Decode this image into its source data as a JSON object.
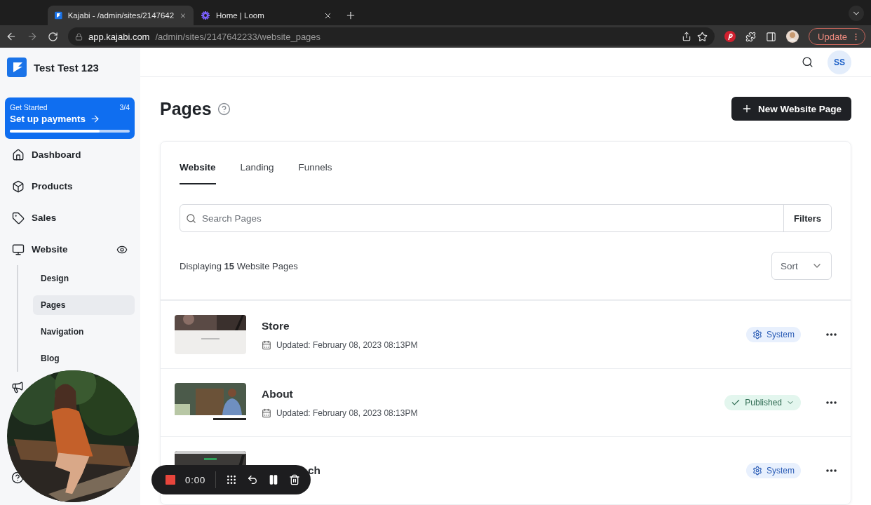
{
  "browser": {
    "tabs": [
      {
        "title": "Kajabi - /admin/sites/2147642",
        "selected": true
      },
      {
        "title": "Home | Loom",
        "selected": false
      }
    ],
    "url_host": "app.kajabi.com",
    "url_path": "/admin/sites/2147642233/website_pages",
    "update_button": "Update"
  },
  "sidebar": {
    "site_name": "Test Test 123",
    "get_started": {
      "label": "Get Started",
      "count": "3/4",
      "title": "Set up payments",
      "level": 0.75
    },
    "items": [
      {
        "label": "Dashboard",
        "selected": false
      },
      {
        "label": "Products",
        "selected": false
      },
      {
        "label": "Sales",
        "selected": false
      },
      {
        "label": "Website",
        "selected": false,
        "children": [
          {
            "label": "Design",
            "selected": false
          },
          {
            "label": "Pages",
            "selected": true
          },
          {
            "label": "Navigation",
            "selected": false
          },
          {
            "label": "Blog",
            "selected": false
          }
        ]
      }
    ]
  },
  "header": {
    "avatar": "SS"
  },
  "page": {
    "title": "Pages",
    "new_button": "New Website Page",
    "tabs": [
      {
        "label": "Website",
        "selected": true
      },
      {
        "label": "Landing",
        "selected": false
      },
      {
        "label": "Funnels",
        "selected": false
      }
    ],
    "search": {
      "placeholder": "Search Pages"
    },
    "filters": "Filters",
    "display_text": "Displaying **15** Website Pages",
    "sort": "Sort",
    "rows": [
      {
        "title": "Store",
        "updated": "Updated: February 08, 2023 08:13PM",
        "status": {
          "kind": "system",
          "label": "System"
        }
      },
      {
        "title": "About",
        "updated": "Updated: February 08, 2023 08:13PM",
        "status": {
          "kind": "published",
          "label": "Published"
        }
      },
      {
        "title": "ch",
        "partial": true,
        "status": {
          "kind": "system",
          "label": "System"
        }
      }
    ]
  },
  "recorder": {
    "time": "0:00"
  }
}
